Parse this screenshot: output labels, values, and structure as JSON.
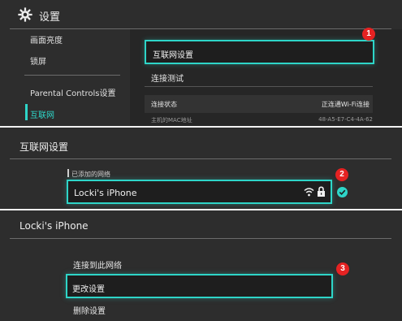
{
  "settings_panel": {
    "title": "设置",
    "sidebar": {
      "items": [
        {
          "label": "画面亮度"
        },
        {
          "label": "锁屏"
        },
        {
          "label": "Parental Controls设置"
        },
        {
          "label": "互联网"
        }
      ],
      "active_index": 3
    },
    "main": {
      "internet_settings_label": "互联网设置",
      "connection_test_label": "连接测试",
      "connection_status_label": "连接状态",
      "connection_status_value": "正连通Wi-Fi连接",
      "mac_label": "主机的MAC地址",
      "mac_value": "48-A5-E7-C4-4A-62"
    }
  },
  "internet_panel": {
    "title": "互联网设置",
    "section_label": "已添加的网络",
    "network_name": "Locki's iPhone",
    "icons": [
      "wifi-icon",
      "lock-icon",
      "connected-check-icon"
    ]
  },
  "network_panel": {
    "title": "Locki's iPhone",
    "options": [
      {
        "label": "连接到此网络"
      },
      {
        "label": "更改设置"
      },
      {
        "label": "删除设置"
      }
    ],
    "selected_index": 1
  },
  "steps": {
    "one": "1",
    "two": "2",
    "three": "3"
  },
  "colors": {
    "accent": "#2ed5c8",
    "badge": "#e52222",
    "background": "#2d2d2d"
  }
}
